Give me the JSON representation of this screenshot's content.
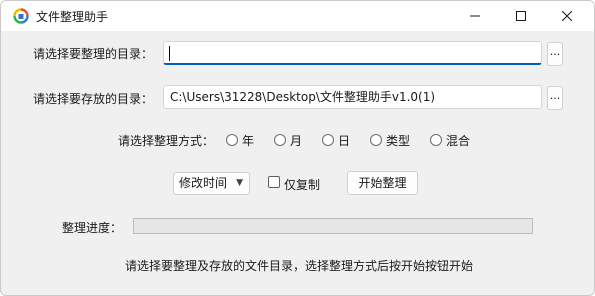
{
  "window": {
    "title": "文件整理助手"
  },
  "form": {
    "source_label": "请选择要整理的目录：",
    "source_value": "",
    "target_label": "请选择要存放的目录：",
    "target_value": "C:\\Users\\31228\\Desktop\\文件整理助手v1.0(1)",
    "browse_label": "...",
    "mode_label": "请选择整理方式：",
    "modes": [
      "年",
      "月",
      "日",
      "类型",
      "混合"
    ],
    "time_select_value": "修改时间",
    "copy_only_label": "仅复制",
    "copy_only_checked": false,
    "start_button": "开始整理",
    "progress_label": "整理进度：",
    "progress_value": 0,
    "hint": "请选择要整理及存放的文件目录，选择整理方式后按开始按钮开始"
  },
  "colors": {
    "accent": "#005fb8",
    "progress_fill": "#06b025"
  }
}
